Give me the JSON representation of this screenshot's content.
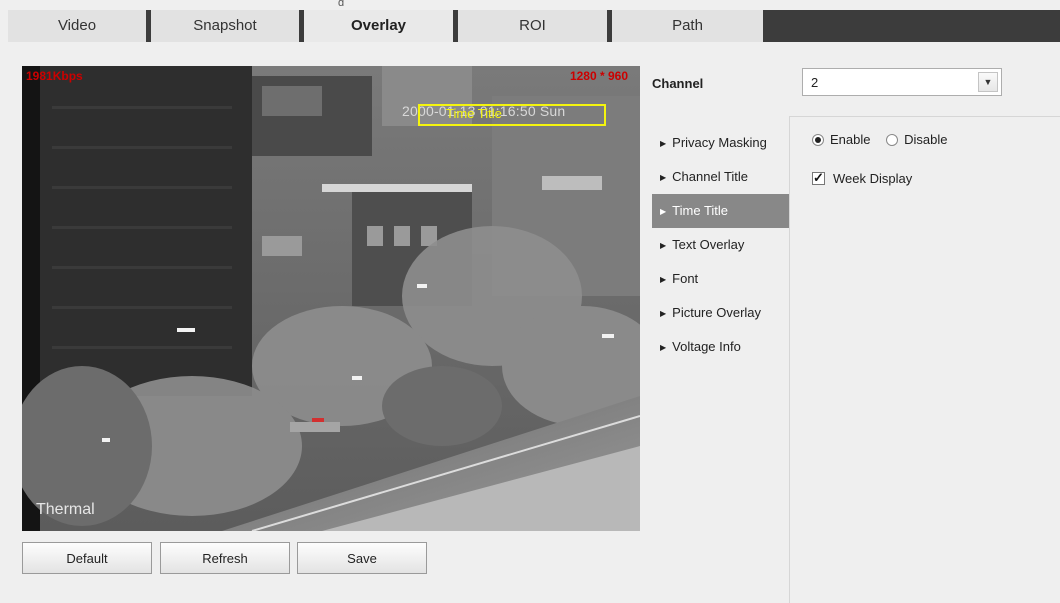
{
  "top_fragment": "g",
  "tabs": [
    {
      "label": "Video"
    },
    {
      "label": "Snapshot"
    },
    {
      "label": "Overlay",
      "active": true
    },
    {
      "label": "ROI"
    },
    {
      "label": "Path"
    }
  ],
  "video": {
    "bitrate": "1981Kbps",
    "resolution": "1280 * 960",
    "time_overlay": "2000-01-13 01:16:50 Sun",
    "time_title_label": "Time Title",
    "source_label": "Thermal"
  },
  "channel": {
    "label": "Channel",
    "value": "2"
  },
  "menu": [
    {
      "label": "Privacy Masking"
    },
    {
      "label": "Channel Title"
    },
    {
      "label": "Time Title",
      "active": true
    },
    {
      "label": "Text Overlay"
    },
    {
      "label": "Font"
    },
    {
      "label": "Picture Overlay"
    },
    {
      "label": "Voltage Info"
    }
  ],
  "settings": {
    "enable_label": "Enable",
    "disable_label": "Disable",
    "enable_selected": true,
    "week_display_label": "Week Display",
    "week_display_checked": true
  },
  "buttons": {
    "default": "Default",
    "refresh": "Refresh",
    "save": "Save"
  },
  "colors": {
    "osd_red": "#cc0000",
    "time_box": "#f4f40e",
    "active_menu_bg": "#888888"
  }
}
